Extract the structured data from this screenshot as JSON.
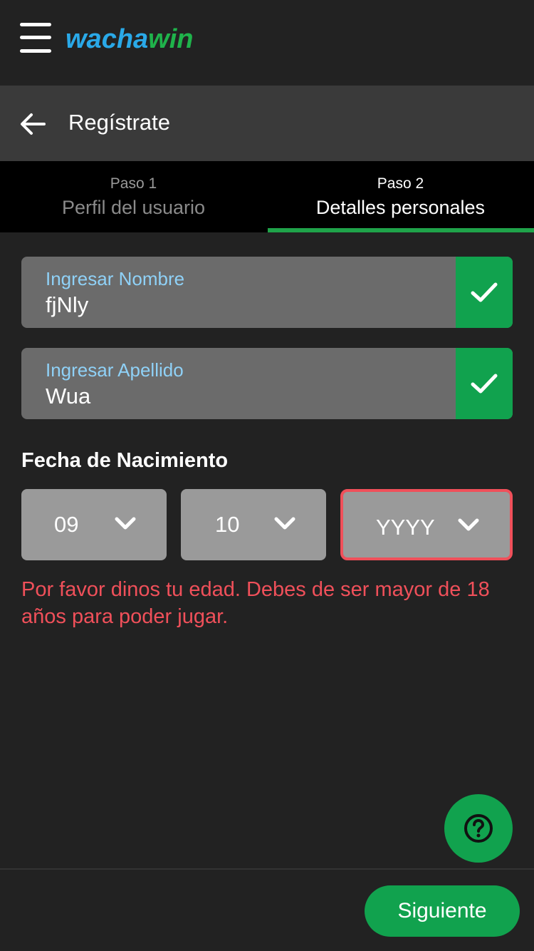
{
  "header": {
    "logo_part1": "wacha",
    "logo_part2": "win"
  },
  "subheader": {
    "title": "Regístrate"
  },
  "steps": [
    {
      "number": "Paso 1",
      "label": "Perfil del usuario",
      "active": false
    },
    {
      "number": "Paso 2",
      "label": "Detalles personales",
      "active": true
    }
  ],
  "form": {
    "first_name": {
      "label": "Ingresar Nombre",
      "value": "fjNly",
      "valid": true
    },
    "last_name": {
      "label": "Ingresar Apellido",
      "value": "Wua",
      "valid": true
    },
    "dob": {
      "label": "Fecha de Nacimiento",
      "day": "09",
      "month": "10",
      "year": "YYYY",
      "error": "Por favor dinos tu edad. Debes de ser mayor de 18 años para poder jugar."
    }
  },
  "footer": {
    "next_label": "Siguiente"
  },
  "colors": {
    "background": "#222222",
    "accent_green": "#11a24e",
    "logo_blue": "#2aa9e8",
    "label_blue": "#8fd1f7",
    "error_red": "#f0505a"
  },
  "icons": {
    "menu": "hamburger-icon",
    "back": "arrow-left-icon",
    "valid": "check-icon",
    "dropdown": "chevron-down-icon",
    "help": "question-circle-icon"
  }
}
